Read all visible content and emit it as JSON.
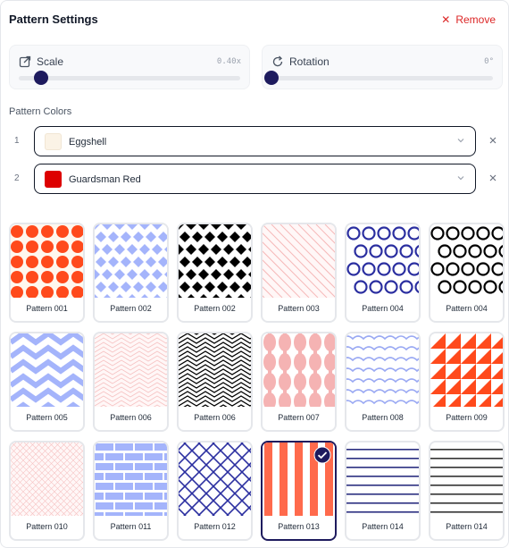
{
  "header": {
    "title": "Pattern Settings",
    "remove_label": "Remove"
  },
  "scale": {
    "label": "Scale",
    "value": "0.40x",
    "fraction": 0.1
  },
  "rotation": {
    "label": "Rotation",
    "value": "0°",
    "fraction": 0.0
  },
  "colors": {
    "section_label": "Pattern Colors",
    "items": [
      {
        "index": "1",
        "name": "Eggshell",
        "color": "#fbf3e6"
      },
      {
        "index": "2",
        "name": "Guardsman Red",
        "color": "#dd0000"
      }
    ]
  },
  "patterns": [
    {
      "label": "Pattern 001",
      "kind": "dots",
      "fg": "#ff4a1c",
      "bg": "#fff7ee"
    },
    {
      "label": "Pattern 002",
      "kind": "lattice",
      "fg": "#a4b4fb",
      "bg": "#ffffff"
    },
    {
      "label": "Pattern 002",
      "kind": "lattice",
      "fg": "#000000",
      "bg": "#ffffff"
    },
    {
      "label": "Pattern 003",
      "kind": "diag-thin",
      "fg": "#f6b9b9",
      "bg": "#fff7f7"
    },
    {
      "label": "Pattern 004",
      "kind": "rings",
      "fg": "#2b2fa0",
      "bg": "#ffffff"
    },
    {
      "label": "Pattern 004",
      "kind": "rings",
      "fg": "#000000",
      "bg": "#ffffff"
    },
    {
      "label": "Pattern 005",
      "kind": "chevron",
      "fg": "#a4b4fb",
      "bg": "#ffffff"
    },
    {
      "label": "Pattern 006",
      "kind": "chevron-thin",
      "fg": "#f6c3c3",
      "bg": "#fff7f7"
    },
    {
      "label": "Pattern 006",
      "kind": "chevron-thin",
      "fg": "#000000",
      "bg": "#ffffff"
    },
    {
      "label": "Pattern 007",
      "kind": "ogee",
      "fg": "#f5b3b3",
      "bg": "#ffffff"
    },
    {
      "label": "Pattern 008",
      "kind": "waves",
      "fg": "#9aa9f3",
      "bg": "#ffffff"
    },
    {
      "label": "Pattern 009",
      "kind": "triangles",
      "fg": "#ff4a1c",
      "bg": "#ffffff"
    },
    {
      "label": "Pattern 010",
      "kind": "crosshatch",
      "fg": "#f6c3c3",
      "bg": "#fff7f7"
    },
    {
      "label": "Pattern 011",
      "kind": "bricks",
      "fg": "#a4b4fb",
      "bg": "#ffffff"
    },
    {
      "label": "Pattern 012",
      "kind": "diamonds",
      "fg": "#2b2fa0",
      "bg": "#ffffff"
    },
    {
      "label": "Pattern 013",
      "kind": "vstripes",
      "fg": "#ff6a4c",
      "bg": "#ffffff",
      "selected": true
    },
    {
      "label": "Pattern 014",
      "kind": "hlines",
      "fg": "#2b2f80",
      "bg": "#ffffff"
    },
    {
      "label": "Pattern 014",
      "kind": "hlines",
      "fg": "#333333",
      "bg": "#ffffff"
    }
  ],
  "accent": "#1e1b5e"
}
